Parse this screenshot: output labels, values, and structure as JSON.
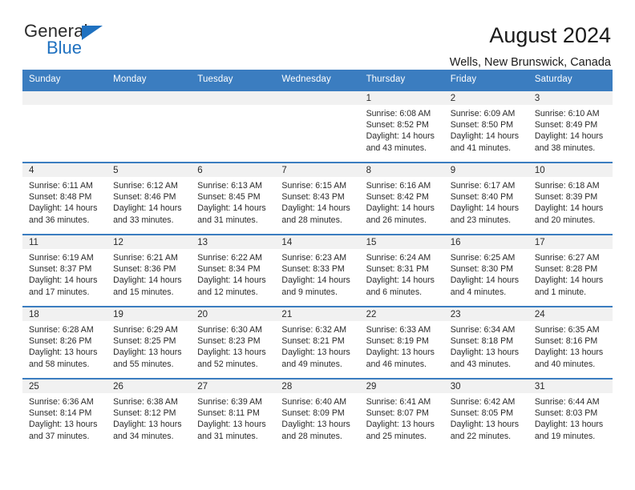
{
  "brand": {
    "name_part1": "General",
    "name_part2": "Blue",
    "triangle_color": "#1f71c0"
  },
  "header": {
    "title": "August 2024",
    "subtitle": "Wells, New Brunswick, Canada"
  },
  "theme": {
    "header_blue": "#3b7dc0",
    "cell_gray": "#f1f1f1",
    "text": "#2a2a2a"
  },
  "weekdays": [
    "Sunday",
    "Monday",
    "Tuesday",
    "Wednesday",
    "Thursday",
    "Friday",
    "Saturday"
  ],
  "weeks": [
    [
      {
        "day": "",
        "sunrise": "",
        "sunset": "",
        "daylight": ""
      },
      {
        "day": "",
        "sunrise": "",
        "sunset": "",
        "daylight": ""
      },
      {
        "day": "",
        "sunrise": "",
        "sunset": "",
        "daylight": ""
      },
      {
        "day": "",
        "sunrise": "",
        "sunset": "",
        "daylight": ""
      },
      {
        "day": "1",
        "sunrise": "Sunrise: 6:08 AM",
        "sunset": "Sunset: 8:52 PM",
        "daylight": "Daylight: 14 hours and 43 minutes."
      },
      {
        "day": "2",
        "sunrise": "Sunrise: 6:09 AM",
        "sunset": "Sunset: 8:50 PM",
        "daylight": "Daylight: 14 hours and 41 minutes."
      },
      {
        "day": "3",
        "sunrise": "Sunrise: 6:10 AM",
        "sunset": "Sunset: 8:49 PM",
        "daylight": "Daylight: 14 hours and 38 minutes."
      }
    ],
    [
      {
        "day": "4",
        "sunrise": "Sunrise: 6:11 AM",
        "sunset": "Sunset: 8:48 PM",
        "daylight": "Daylight: 14 hours and 36 minutes."
      },
      {
        "day": "5",
        "sunrise": "Sunrise: 6:12 AM",
        "sunset": "Sunset: 8:46 PM",
        "daylight": "Daylight: 14 hours and 33 minutes."
      },
      {
        "day": "6",
        "sunrise": "Sunrise: 6:13 AM",
        "sunset": "Sunset: 8:45 PM",
        "daylight": "Daylight: 14 hours and 31 minutes."
      },
      {
        "day": "7",
        "sunrise": "Sunrise: 6:15 AM",
        "sunset": "Sunset: 8:43 PM",
        "daylight": "Daylight: 14 hours and 28 minutes."
      },
      {
        "day": "8",
        "sunrise": "Sunrise: 6:16 AM",
        "sunset": "Sunset: 8:42 PM",
        "daylight": "Daylight: 14 hours and 26 minutes."
      },
      {
        "day": "9",
        "sunrise": "Sunrise: 6:17 AM",
        "sunset": "Sunset: 8:40 PM",
        "daylight": "Daylight: 14 hours and 23 minutes."
      },
      {
        "day": "10",
        "sunrise": "Sunrise: 6:18 AM",
        "sunset": "Sunset: 8:39 PM",
        "daylight": "Daylight: 14 hours and 20 minutes."
      }
    ],
    [
      {
        "day": "11",
        "sunrise": "Sunrise: 6:19 AM",
        "sunset": "Sunset: 8:37 PM",
        "daylight": "Daylight: 14 hours and 17 minutes."
      },
      {
        "day": "12",
        "sunrise": "Sunrise: 6:21 AM",
        "sunset": "Sunset: 8:36 PM",
        "daylight": "Daylight: 14 hours and 15 minutes."
      },
      {
        "day": "13",
        "sunrise": "Sunrise: 6:22 AM",
        "sunset": "Sunset: 8:34 PM",
        "daylight": "Daylight: 14 hours and 12 minutes."
      },
      {
        "day": "14",
        "sunrise": "Sunrise: 6:23 AM",
        "sunset": "Sunset: 8:33 PM",
        "daylight": "Daylight: 14 hours and 9 minutes."
      },
      {
        "day": "15",
        "sunrise": "Sunrise: 6:24 AM",
        "sunset": "Sunset: 8:31 PM",
        "daylight": "Daylight: 14 hours and 6 minutes."
      },
      {
        "day": "16",
        "sunrise": "Sunrise: 6:25 AM",
        "sunset": "Sunset: 8:30 PM",
        "daylight": "Daylight: 14 hours and 4 minutes."
      },
      {
        "day": "17",
        "sunrise": "Sunrise: 6:27 AM",
        "sunset": "Sunset: 8:28 PM",
        "daylight": "Daylight: 14 hours and 1 minute."
      }
    ],
    [
      {
        "day": "18",
        "sunrise": "Sunrise: 6:28 AM",
        "sunset": "Sunset: 8:26 PM",
        "daylight": "Daylight: 13 hours and 58 minutes."
      },
      {
        "day": "19",
        "sunrise": "Sunrise: 6:29 AM",
        "sunset": "Sunset: 8:25 PM",
        "daylight": "Daylight: 13 hours and 55 minutes."
      },
      {
        "day": "20",
        "sunrise": "Sunrise: 6:30 AM",
        "sunset": "Sunset: 8:23 PM",
        "daylight": "Daylight: 13 hours and 52 minutes."
      },
      {
        "day": "21",
        "sunrise": "Sunrise: 6:32 AM",
        "sunset": "Sunset: 8:21 PM",
        "daylight": "Daylight: 13 hours and 49 minutes."
      },
      {
        "day": "22",
        "sunrise": "Sunrise: 6:33 AM",
        "sunset": "Sunset: 8:19 PM",
        "daylight": "Daylight: 13 hours and 46 minutes."
      },
      {
        "day": "23",
        "sunrise": "Sunrise: 6:34 AM",
        "sunset": "Sunset: 8:18 PM",
        "daylight": "Daylight: 13 hours and 43 minutes."
      },
      {
        "day": "24",
        "sunrise": "Sunrise: 6:35 AM",
        "sunset": "Sunset: 8:16 PM",
        "daylight": "Daylight: 13 hours and 40 minutes."
      }
    ],
    [
      {
        "day": "25",
        "sunrise": "Sunrise: 6:36 AM",
        "sunset": "Sunset: 8:14 PM",
        "daylight": "Daylight: 13 hours and 37 minutes."
      },
      {
        "day": "26",
        "sunrise": "Sunrise: 6:38 AM",
        "sunset": "Sunset: 8:12 PM",
        "daylight": "Daylight: 13 hours and 34 minutes."
      },
      {
        "day": "27",
        "sunrise": "Sunrise: 6:39 AM",
        "sunset": "Sunset: 8:11 PM",
        "daylight": "Daylight: 13 hours and 31 minutes."
      },
      {
        "day": "28",
        "sunrise": "Sunrise: 6:40 AM",
        "sunset": "Sunset: 8:09 PM",
        "daylight": "Daylight: 13 hours and 28 minutes."
      },
      {
        "day": "29",
        "sunrise": "Sunrise: 6:41 AM",
        "sunset": "Sunset: 8:07 PM",
        "daylight": "Daylight: 13 hours and 25 minutes."
      },
      {
        "day": "30",
        "sunrise": "Sunrise: 6:42 AM",
        "sunset": "Sunset: 8:05 PM",
        "daylight": "Daylight: 13 hours and 22 minutes."
      },
      {
        "day": "31",
        "sunrise": "Sunrise: 6:44 AM",
        "sunset": "Sunset: 8:03 PM",
        "daylight": "Daylight: 13 hours and 19 minutes."
      }
    ]
  ]
}
